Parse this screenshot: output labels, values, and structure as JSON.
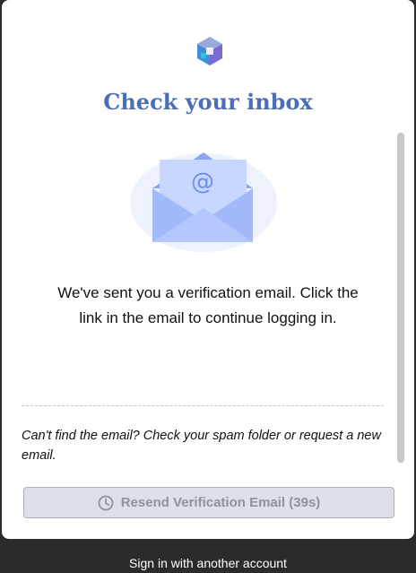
{
  "dialog": {
    "title": "Check your inbox",
    "message": "We've sent you a verification email. Click the link in the email to continue logging in.",
    "hint": "Can't find the email? Check your spam folder or request a new email.",
    "resend_label": "Resend Verification Email (39s)",
    "envelope_symbol": "@"
  },
  "footer": {
    "switch_account_label": "Sign in with another account"
  },
  "icons": {
    "logo": "cube-logo-icon",
    "envelope": "envelope-icon",
    "clock": "clock-icon"
  },
  "colors": {
    "title": "#4a6fb8",
    "envelope": "#98b4f9",
    "button_bg": "#dde0e6",
    "button_text": "#8b93a1",
    "backdrop": "#2b2b2e"
  }
}
